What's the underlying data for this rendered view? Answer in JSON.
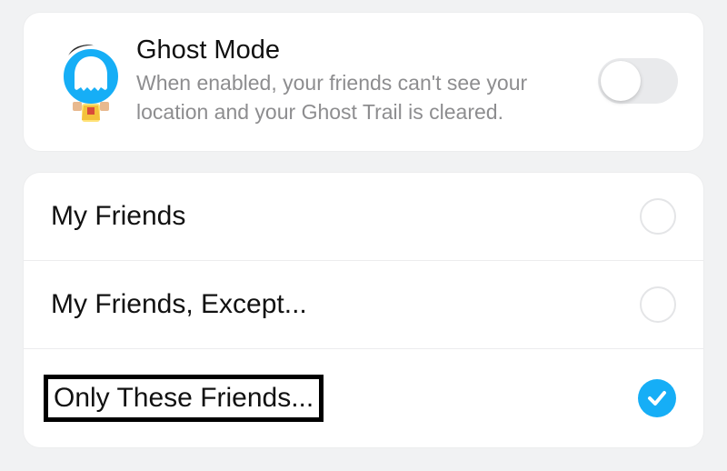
{
  "ghostMode": {
    "title": "Ghost Mode",
    "description": "When enabled, your friends can't see your location and your Ghost Trail is cleared.",
    "enabled": false
  },
  "locationOptions": [
    {
      "label": "My Friends",
      "selected": false,
      "highlighted": false
    },
    {
      "label": "My Friends, Except...",
      "selected": false,
      "highlighted": false
    },
    {
      "label": "Only These Friends...",
      "selected": true,
      "highlighted": true
    }
  ],
  "colors": {
    "accent": "#16aef6"
  }
}
